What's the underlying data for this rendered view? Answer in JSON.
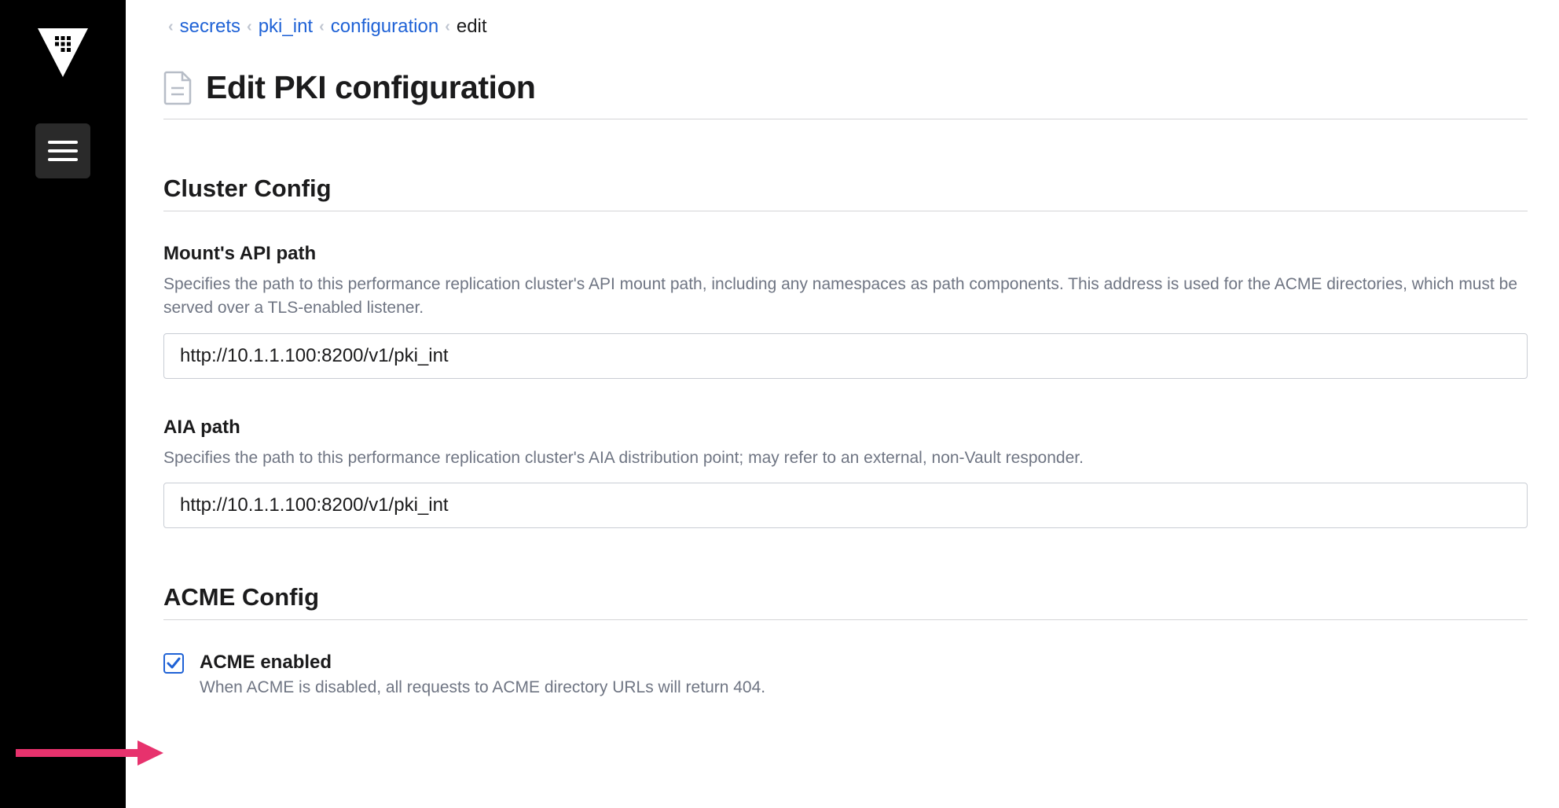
{
  "breadcrumbs": {
    "items": [
      {
        "label": "secrets",
        "link": true
      },
      {
        "label": "pki_int",
        "link": true
      },
      {
        "label": "configuration",
        "link": true
      },
      {
        "label": "edit",
        "link": false
      }
    ]
  },
  "page": {
    "title": "Edit PKI configuration"
  },
  "cluster_config": {
    "section_title": "Cluster Config",
    "mount_api_path": {
      "label": "Mount's API path",
      "description": "Specifies the path to this performance replication cluster's API mount path, including any namespaces as path components. This address is used for the ACME directories, which must be served over a TLS-enabled listener.",
      "value": "http://10.1.1.100:8200/v1/pki_int"
    },
    "aia_path": {
      "label": "AIA path",
      "description": "Specifies the path to this performance replication cluster's AIA distribution point; may refer to an external, non-Vault responder.",
      "value": "http://10.1.1.100:8200/v1/pki_int"
    }
  },
  "acme_config": {
    "section_title": "ACME Config",
    "enabled": {
      "label": "ACME enabled",
      "description": "When ACME is disabled, all requests to ACME directory URLs will return 404.",
      "checked": true
    }
  },
  "colors": {
    "link": "#1f62d6",
    "text": "#1b1b1c",
    "muted": "#6f7583",
    "border": "#d4d4d7",
    "annotation": "#e7326d"
  }
}
